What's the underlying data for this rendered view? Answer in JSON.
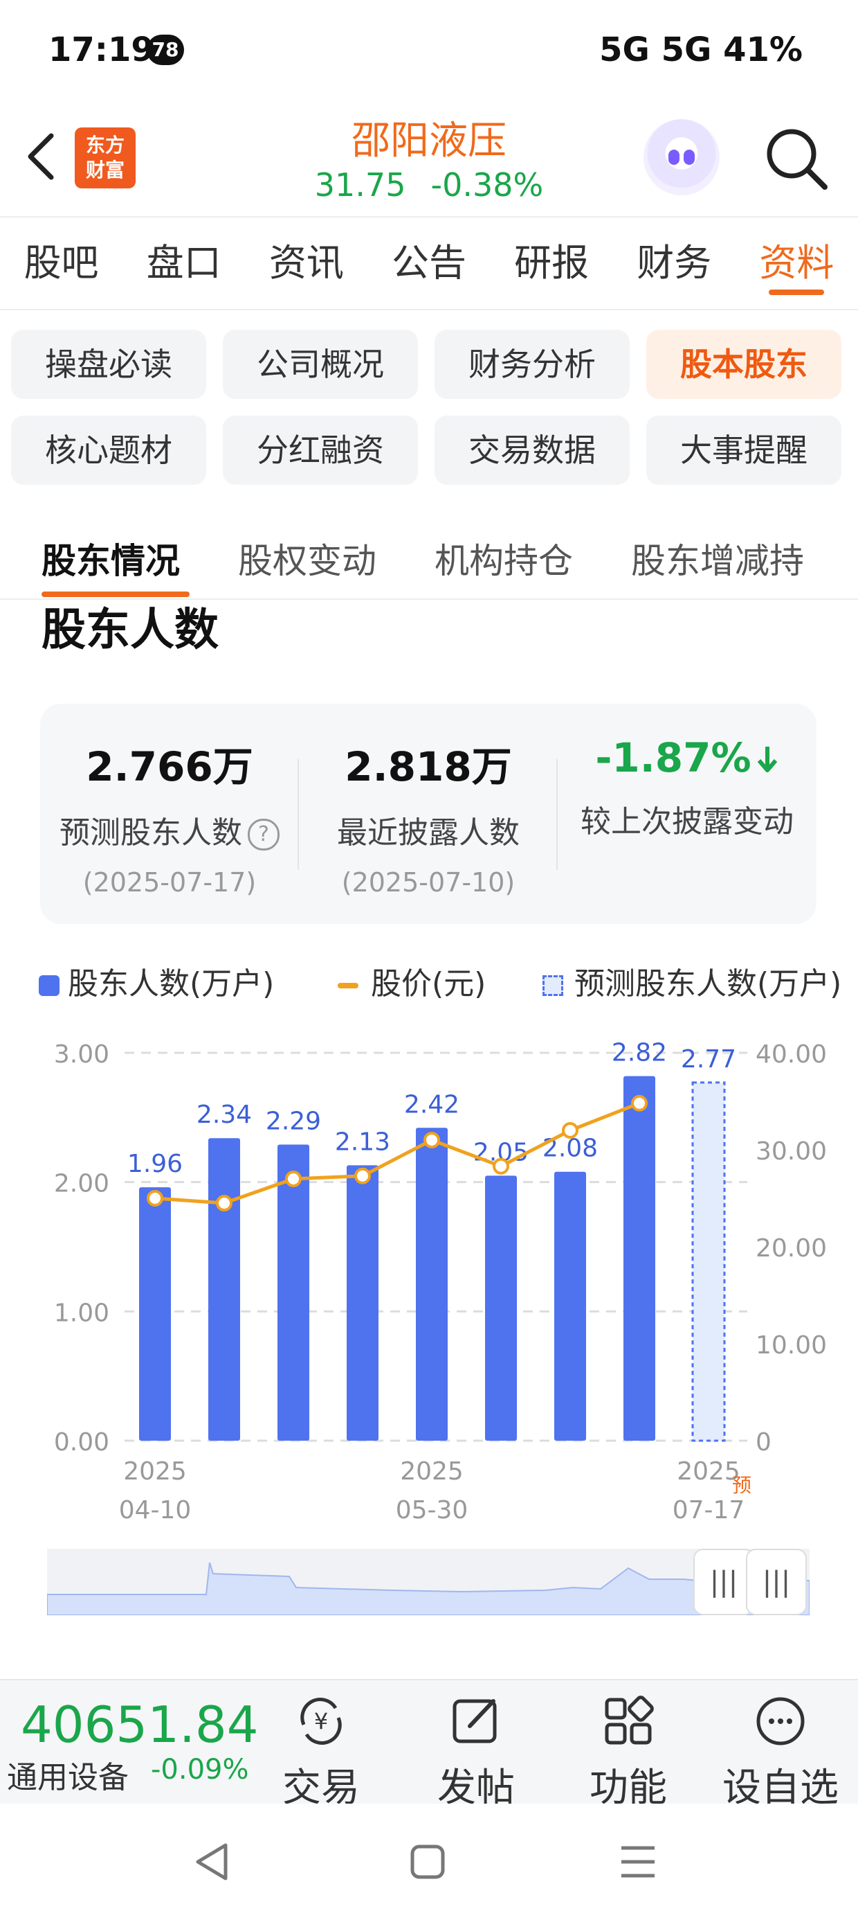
{
  "status_bar": {
    "time": "17:19",
    "badge": "78",
    "right": "5G  5G  41%"
  },
  "header": {
    "stock_name": "邵阳液压",
    "price": "31.75",
    "change": "-0.38%",
    "logo_line1": "东方",
    "logo_line2": "财富"
  },
  "main_tabs": [
    "股吧",
    "盘口",
    "资讯",
    "公告",
    "研报",
    "财务",
    "资料"
  ],
  "sub_menu": [
    "操盘必读",
    "公司概况",
    "财务分析",
    "股本股东",
    "核心题材",
    "分红融资",
    "交易数据",
    "大事提醒"
  ],
  "section_tabs": [
    "股东情况",
    "股权变动",
    "机构持仓",
    "股东增减持"
  ],
  "section_title": "股东人数",
  "summary": [
    {
      "value": "2.766万",
      "label": "预测股东人数",
      "date": "(2025-07-17)",
      "help_icon": "?"
    },
    {
      "value": "2.818万",
      "label": "最近披露人数",
      "date": "(2025-07-10)"
    },
    {
      "value": "-1.87%",
      "label": "较上次披露变动",
      "arrow": "arrow-down"
    }
  ],
  "legend": [
    "股东人数(万户)",
    "股价(元)",
    "预测股东人数(万户)"
  ],
  "chart_data": {
    "type": "bar",
    "left_axis_ticks": [
      "3.00",
      "2.00",
      "1.00",
      "0.00"
    ],
    "right_axis_ticks": [
      "40.00",
      "30.00",
      "20.00",
      "10.00",
      "0"
    ],
    "ylim_left": [
      0,
      3
    ],
    "ylim_right": [
      0,
      40
    ],
    "series": [
      {
        "name": "股东人数(万户)",
        "values": [
          1.96,
          2.34,
          2.29,
          2.13,
          2.42,
          2.05,
          2.08,
          2.82
        ],
        "labels": [
          "1.96",
          "2.34",
          "2.29",
          "2.13",
          "2.42",
          "2.05",
          "2.08",
          "2.82"
        ],
        "color": "#4f72ee"
      },
      {
        "name": "股价(元)",
        "values": [
          25.0,
          24.5,
          27.0,
          27.3,
          31.0,
          28.3,
          32.0,
          34.8
        ],
        "color": "#f0a21e"
      },
      {
        "name": "预测股东人数(万户)",
        "values": [
          2.77
        ],
        "labels": [
          "2.77"
        ],
        "color": "#4f72ee"
      }
    ],
    "x_tick_years": [
      "2025",
      "2025",
      "2025"
    ],
    "x_tick_dates": [
      "04-10",
      "05-30",
      "07-17"
    ],
    "forecast_marker": "预",
    "grid": true
  },
  "minimap": {
    "handle_glyph": "|||"
  },
  "bottom_bar": {
    "index_value": "40651.84",
    "index_name": "通用设备",
    "index_change": "-0.09%",
    "items": [
      "交易",
      "发帖",
      "功能",
      "设自选"
    ]
  }
}
